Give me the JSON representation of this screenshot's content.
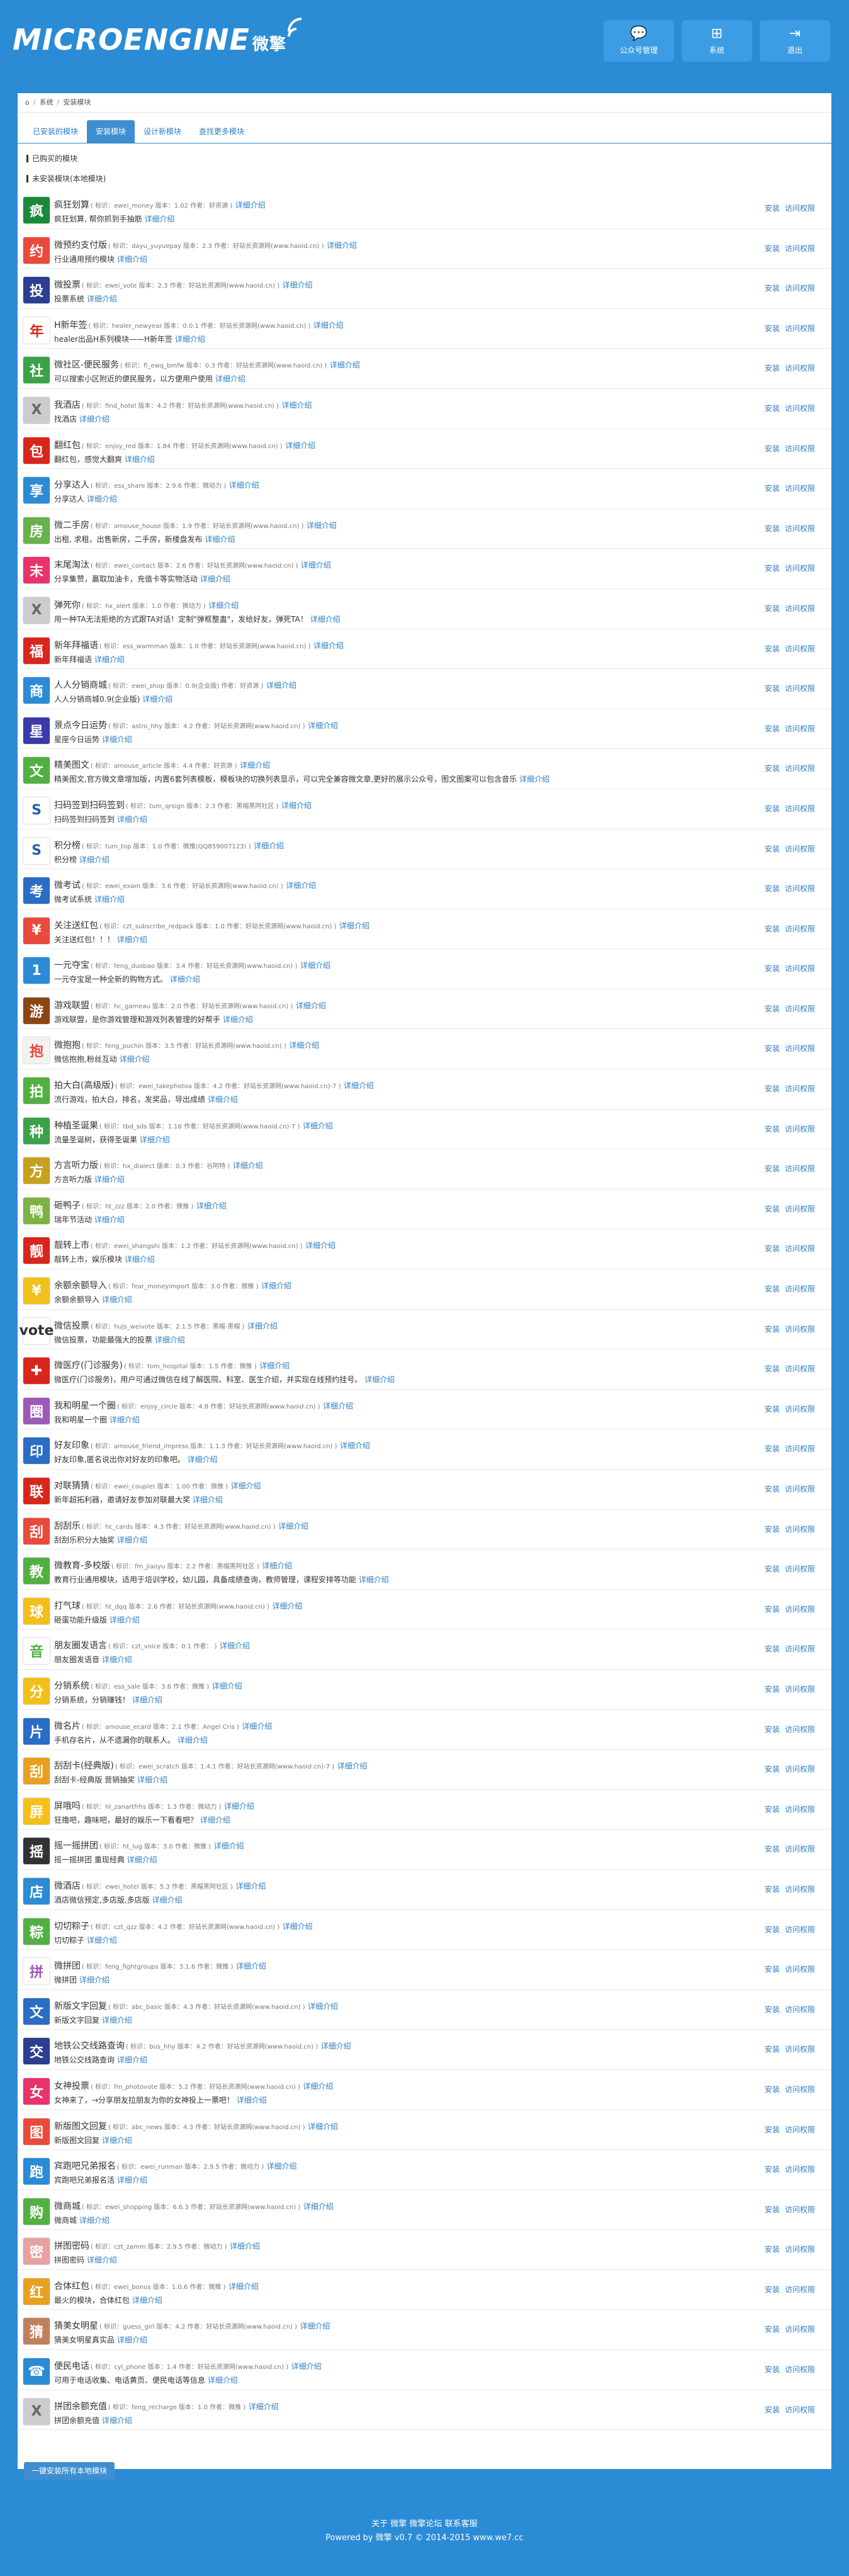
{
  "header": {
    "logo": "MICROENGINE",
    "logo_cn": "微擎",
    "nav": [
      {
        "icon": "chat-icon",
        "label": "公众号管理"
      },
      {
        "icon": "sitemap-icon",
        "label": "系统"
      },
      {
        "icon": "logout-icon",
        "label": "退出"
      }
    ]
  },
  "breadcrumb": {
    "home_icon": "home-icon",
    "items": [
      "系统",
      "安装模块"
    ]
  },
  "tabs": [
    {
      "label": "已安装的模块"
    },
    {
      "label": "安装模块"
    },
    {
      "label": "设计新模块"
    },
    {
      "label": "查找更多模块"
    }
  ],
  "sections": {
    "purchased": "已购买的模块",
    "uninstalled": "未安装模块(本地模块)"
  },
  "row_actions": {
    "install": "安装",
    "access": "访问权限"
  },
  "detail_link": "详细介绍",
  "modules": [
    {
      "name": "疯狂划算",
      "meta": "( 标识：ewei_money  版本：1.02  作者：好资源 )",
      "desc": "疯狂划算, 帮你抓到手抽筋",
      "color": "#1a8a3a",
      "glyph": "疯"
    },
    {
      "name": "微预约支付版",
      "meta": "( 标识：dayu_yuyuepay  版本：2.3  作者：好站长资源网(www.haoid.cn) )",
      "desc": "行业通用预约模块",
      "color": "#e84a3c",
      "glyph": "约"
    },
    {
      "name": "微投票",
      "meta": "( 标识：ewei_vote  版本：2.3  作者：好站长资源网(www.haoid.cn) )",
      "desc": "投票系统",
      "color": "#2c3e90",
      "glyph": "投"
    },
    {
      "name": "H新年签",
      "meta": "( 标识：healer_newyear  版本：0.0.1  作者：好站长资源网(www.haoid.cn) )",
      "desc": "healer出品H系列模块——H新年签",
      "color": "#ffffff",
      "glyph": "年",
      "fg": "#d9261c"
    },
    {
      "name": "微社区-便民服务",
      "meta": "( 标识：fl_ewq_bmfw  版本：0.3  作者：好站长资源网(www.haoid.cn) )",
      "desc": "可以搜索小区附近的便民服务，以方便用户使用",
      "color": "#3aa34a",
      "glyph": "社"
    },
    {
      "name": "我酒店",
      "meta": "( 标识：find_hotel  版本：4.2  作者：好站长资源网(www.haoid.cn) )",
      "desc": "找酒店",
      "color": "#cccccc",
      "glyph": "X",
      "fg": "#666"
    },
    {
      "name": "翻红包",
      "meta": "( 标识：enjoy_red  版本：1.84  作者：好站长资源网(www.haoid.cn) )",
      "desc": "翻红包，感觉大翻爽",
      "color": "#d9261c",
      "glyph": "包"
    },
    {
      "name": "分享达人",
      "meta": "( 标识：ess_share  版本：2.9.6  作者：微动力 )",
      "desc": "分享达人",
      "color": "#2b8bd5",
      "glyph": "享"
    },
    {
      "name": "微二手房",
      "meta": "( 标识：amouse_house  版本：1.9  作者：好站长资源网(www.haoid.cn) )",
      "desc": "出租, 求租，出售新房，二手房，新楼盘发布",
      "color": "#6ab04c",
      "glyph": "房"
    },
    {
      "name": "末尾淘汰",
      "meta": "( 标识：ewei_contact  版本：2.6  作者：好站长资源网(www.haoid.cn) )",
      "desc": "分享集赞，赢取加油卡，充值卡等实物活动",
      "color": "#e8336b",
      "glyph": "末"
    },
    {
      "name": "弹死你",
      "meta": "( 标识：hx_alert  版本：1.0  作者：微动力 )",
      "desc": "用一种TA无法拒绝的方式跟TA对话！定制\"弹框整蛊\"，发给好友，弹死TA！",
      "color": "#cccccc",
      "glyph": "X",
      "fg": "#666"
    },
    {
      "name": "新年拜福语",
      "meta": "( 标识：ess_warmman  版本：1.0  作者：好站长资源网(www.haoid.cn) )",
      "desc": "新年拜福语",
      "color": "#d9261c",
      "glyph": "福"
    },
    {
      "name": "人人分销商城",
      "meta": "( 标识：ewei_shop  版本：0.9(企业版)  作者：好资源 )",
      "desc": "人人分销商城0.9(企业版)",
      "color": "#2b8bd5",
      "glyph": "商"
    },
    {
      "name": "景点今日运势",
      "meta": "( 标识：astro_hhy  版本：4.2  作者：好站长资源网(www.haoid.cn) )",
      "desc": "星座今日运势",
      "color": "#3a3aa8",
      "glyph": "星"
    },
    {
      "name": "精美图文",
      "meta": "( 标识：amouse_article  版本：4.4  作者：好资源 )",
      "desc": "精美图文,官方微文章增加版，内置6套列表模板，模板块的切换列表显示，可以完全兼容微文章,更好的展示公众号，图文图案可以包含音乐",
      "color": "#52b043",
      "glyph": "文"
    },
    {
      "name": "扫码签到扫码签到",
      "meta": "( 标识：tum_qrsign  版本：2.3  作者：黑帽黑阿社区 )",
      "desc": "扫码签到扫码签到",
      "color": "#ffffff",
      "glyph": "S",
      "fg": "#2b5ea6"
    },
    {
      "name": "积分榜",
      "meta": "( 标识：tum_top  版本：1.0  作者：微推(QQ859007123) )",
      "desc": "积分榜",
      "color": "#ffffff",
      "glyph": "S",
      "fg": "#2b5ea6"
    },
    {
      "name": "微考试",
      "meta": "( 标识：ewei_exam  版本：3.6  作者：好站长资源网(www.haoid.cn) )",
      "desc": "微考试系统",
      "color": "#2b6cc4",
      "glyph": "考"
    },
    {
      "name": "关注送红包",
      "meta": "( 标识：czt_subscribe_redpack  版本：1.0  作者：好站长资源网(www.haoid.cn) )",
      "desc": "关注送红包！！！",
      "color": "#e84a3c",
      "glyph": "¥"
    },
    {
      "name": "一元夺宝",
      "meta": "( 标识：feng_duobao  版本：3.4  作者：好站长资源网(www.haoid.cn) )",
      "desc": "一元夺宝是一种全新的购物方式。",
      "color": "#2b8bd5",
      "glyph": "1"
    },
    {
      "name": "游戏联盟",
      "meta": "( 标识：hc_gameau  版本：2.0  作者：好站长资源网(www.haoid.cn) )",
      "desc": "游戏联盟，是你游戏管理和游戏列表管理的好帮手",
      "color": "#8b4513",
      "glyph": "游"
    },
    {
      "name": "微抱抱",
      "meta": "( 标识：feng_puchin  版本：3.5  作者：好站长资源网(www.haoid.cn) )",
      "desc": "微信抱抱,粉丝互动",
      "color": "#f2f2f2",
      "glyph": "抱",
      "fg": "#e84a3c"
    },
    {
      "name": "拍大白(高级版)",
      "meta": "( 标识：ewei_takephotoa  版本：4.2  作者：好站长资源网(www.haoid.cn)-7 )",
      "desc": "流行游戏，拍大白，排名，发奖品，导出成绩",
      "color": "#52b043",
      "glyph": "拍"
    },
    {
      "name": "种植圣诞果",
      "meta": "( 标识：tbd_sds  版本：1.16  作者：好站长资源网(www.haoid.cn)-7 )",
      "desc": "流量圣诞树，获得圣诞果",
      "color": "#3aa34a",
      "glyph": "种"
    },
    {
      "name": "方言听力版",
      "meta": "( 标识：hx_dialect  版本：0.3  作者：谷阿特 )",
      "desc": "方言听力版",
      "color": "#c8a020",
      "glyph": "方"
    },
    {
      "name": "砸鸭子",
      "meta": "( 标识：ht_zzz  版本：2.0  作者：微推 )",
      "desc": "瑞年节活动",
      "color": "#7cb342",
      "glyph": "鸭"
    },
    {
      "name": "靓转上市",
      "meta": "( 标识：ewei_shangshi  版本：1.2  作者：好站长资源网(www.haoid.cn) )",
      "desc": "靓转上市，娱乐模块",
      "color": "#d9261c",
      "glyph": "靓"
    },
    {
      "name": "余额余额导入",
      "meta": "( 标识：fear_moneyimport  版本：3.0  作者：微推 )",
      "desc": "余额余额导入",
      "color": "#f2c01a",
      "glyph": "¥"
    },
    {
      "name": "微信投票",
      "meta": "( 标识：hujs_weivote  版本：2.1.5  作者：黑帽-黑帽 )",
      "desc": "微信投票，功能最强大的投票",
      "color": "#ffffff",
      "glyph": "vote",
      "fg": "#333"
    },
    {
      "name": "微医疗(门诊服务)",
      "meta": "( 标识：tom_hospital  版本：1.5  作者：微推 )",
      "desc": "微医疗(门诊服务)，用户可通过微信在线了解医院、科室、医生介绍，并实现在线预约挂号。",
      "color": "#d9261c",
      "glyph": "✚"
    },
    {
      "name": "我和明星一个圈",
      "meta": "( 标识：enjoy_circle  版本：4.8  作者：好站长资源网(www.haoid.cn) )",
      "desc": "我和明星一个圈",
      "color": "#9c59b6",
      "glyph": "圈"
    },
    {
      "name": "好友印象",
      "meta": "( 标识：amouse_friend_impress  版本：1.1.3  作者：好站长资源网(www.haoid.cn) )",
      "desc": "好友印象,匿名说出你对好友的印象吧。",
      "color": "#2b6cc4",
      "glyph": "印"
    },
    {
      "name": "对联猜猜",
      "meta": "( 标识：ewei_couplet  版本：1.00  作者：微推 )",
      "desc": "新年超拓利器，邀请好友参加对联最大奖",
      "color": "#d9261c",
      "glyph": "联"
    },
    {
      "name": "刮刮乐",
      "meta": "( 标识：hc_cards  版本：4.3  作者：好站长资源网(www.haoid.cn) )",
      "desc": "刮刮乐积分大抽奖",
      "color": "#e84a3c",
      "glyph": "刮"
    },
    {
      "name": "微教育-多校版",
      "meta": "( 标识：fm_jiaoyu  版本：2.2  作者：黑帽黑阿社区 )",
      "desc": "教育行业通用模块，适用于培训学校，幼儿园，具备成绩查询，教师管理，课程安排等功能",
      "color": "#52b043",
      "glyph": "教"
    },
    {
      "name": "打气球",
      "meta": "( 标识：ht_dqq  版本：2.6  作者：好站长资源网(www.haoid.cn) )",
      "desc": "砸蛋功能升级版",
      "color": "#f2c01a",
      "glyph": "球"
    },
    {
      "name": "朋友圈发语言",
      "meta": "( 标识：czt_voice  版本：0.1  作者： )",
      "desc": "朋友圈发语音",
      "color": "#ffffff",
      "glyph": "音",
      "fg": "#52b043"
    },
    {
      "name": "分销系统",
      "meta": "( 标识：ess_sale  版本：3.6  作者：微推 )",
      "desc": "分销系统，分销赚钱！",
      "color": "#f2c01a",
      "glyph": "分"
    },
    {
      "name": "微名片",
      "meta": "( 标识：amouse_ecard  版本：2.1  作者：Angel Cris )",
      "desc": "手机存名片，从不遗漏你的联系人。",
      "color": "#2b6cc4",
      "glyph": "片"
    },
    {
      "name": "刮刮卡(经典版)",
      "meta": "( 标识：ewei_scratch  版本：1.4.1  作者：好站长资源网(www.haoid.cn)-7 )",
      "desc": "刮刮卡-经典版 营销抽奖",
      "color": "#e8a020",
      "glyph": "刮"
    },
    {
      "name": "屏哦吗",
      "meta": "( 标识：hl_zanartfrhs  版本：1.3  作者：微动力 )",
      "desc": "狂撸吧，趣味吧，最好的娱乐一下看看吧？",
      "color": "#f2c01a",
      "glyph": "屏"
    },
    {
      "name": "摇一摇拼团",
      "meta": "( 标识：ht_lug  版本：3.0  作者：微推 )",
      "desc": "摇一摇拼团 重现经典",
      "color": "#333333",
      "glyph": "摇"
    },
    {
      "name": "微酒店",
      "meta": "( 标识：ewei_hotel  版本：5.3  作者：黑帽黑阿社区 )",
      "desc": "酒店微信预定,多店版,多店版",
      "color": "#2b8bd5",
      "glyph": "店"
    },
    {
      "name": "切切粽子",
      "meta": "( 标识：czt_qzz  版本：4.2  作者：好站长资源网(www.haoid.cn) )",
      "desc": "切切粽子",
      "color": "#52b043",
      "glyph": "粽"
    },
    {
      "name": "微拼团",
      "meta": "( 标识：feng_fightgroups  版本：3.1.6  作者：微推 )",
      "desc": "微拼团",
      "color": "#ffffff",
      "glyph": "拼",
      "fg": "#9c59b6"
    },
    {
      "name": "新版文字回复",
      "meta": "( 标识：abc_basic  版本：4.3  作者：好站长资源网(www.haoid.cn) )",
      "desc": "新版文字回复",
      "color": "#2b6cc4",
      "glyph": "文"
    },
    {
      "name": "地铁公交线路查询",
      "meta": "( 标识：bus_hhy  版本：4.2  作者：好站长资源网(www.haoid.cn) )",
      "desc": "地铁公交线路查询",
      "color": "#2c3e90",
      "glyph": "交"
    },
    {
      "name": "女神投票",
      "meta": "( 标识：fm_photovote  版本：5.2  作者：好站长资源网(www.haoid.cn) )",
      "desc": "女神来了，→分享朋友拉朋友为你的女神投上一票吧！",
      "color": "#e8336b",
      "glyph": "女"
    },
    {
      "name": "新版图文回复",
      "meta": "( 标识：abc_news  版本：4.3  作者：好站长资源网(www.haoid.cn) )",
      "desc": "新版图文回复",
      "color": "#e84a3c",
      "glyph": "图"
    },
    {
      "name": "宾跑吧兄弟报名",
      "meta": "( 标识：ewei_runman  版本：2.9.5  作者：微动力 )",
      "desc": "宾跑吧兄弟报名活",
      "color": "#2b8bd5",
      "glyph": "跑"
    },
    {
      "name": "微商城",
      "meta": "( 标识：ewei_shopping  版本：6.6.3  作者：好站长资源网(www.haoid.cn) )",
      "desc": "微商城",
      "color": "#52b043",
      "glyph": "购"
    },
    {
      "name": "拼图密码",
      "meta": "( 标识：czt_zamm  版本：2.9.5  作者：微动力 )",
      "desc": "拼图密码",
      "color": "#e8a0a0",
      "glyph": "密"
    },
    {
      "name": "合体红包",
      "meta": "( 标识：ewei_bonus  版本：1.0.6  作者：微推 )",
      "desc": "最火的模块，合体红包",
      "color": "#e8a020",
      "glyph": "红"
    },
    {
      "name": "猜美女明星",
      "meta": "( 标识：guess_girl  版本：4.2  作者：好站长资源网(www.haoid.cn) )",
      "desc": "猜美女明星真实品",
      "color": "#c08060",
      "glyph": "猜"
    },
    {
      "name": "便民电话",
      "meta": "( 标识：cyl_phone  版本：1.4  作者：好站长资源网(www.haoid.cn) )",
      "desc": "可用于电话收集、电话黄页、便民电话等信息",
      "color": "#2b8bd5",
      "glyph": "☎"
    },
    {
      "name": "拼团余额充值",
      "meta": "( 标识：feng_recharge  版本：1.0  作者：微推 )",
      "desc": "拼团余额充值",
      "color": "#cccccc",
      "glyph": "X",
      "fg": "#666"
    }
  ],
  "bulk_button": "一键安装所有本地模块",
  "footer": {
    "links": "关于 微擎  微擎论坛  联系客服",
    "powered": "Powered by 微擎 v0.7 © 2014-2015 www.we7.cc"
  }
}
